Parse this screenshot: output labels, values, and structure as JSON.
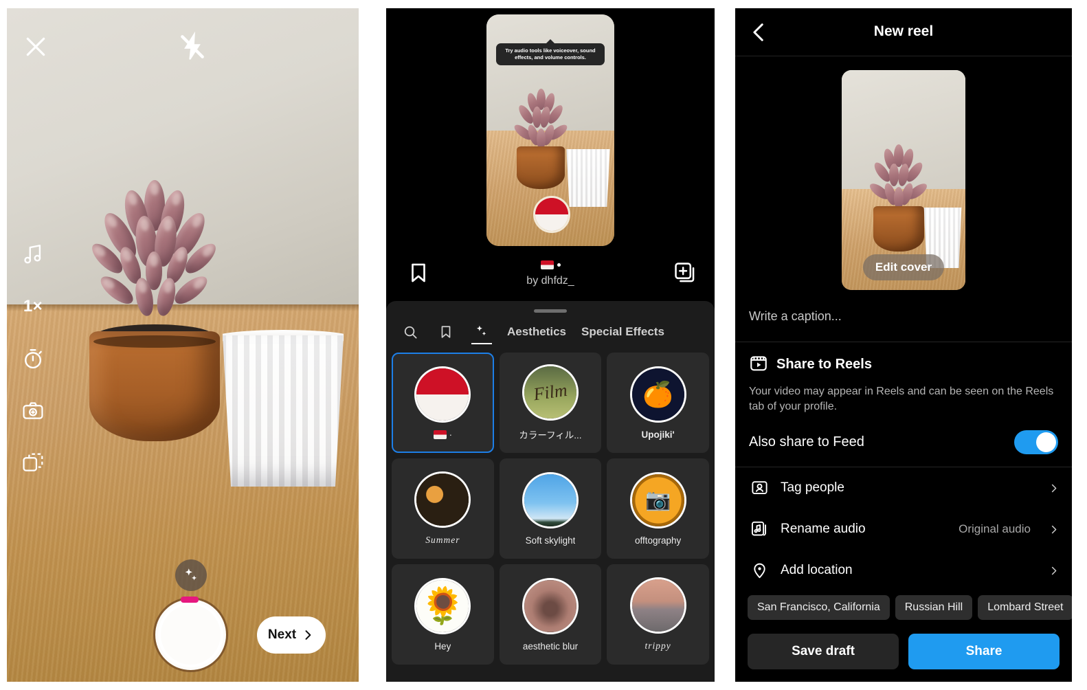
{
  "camera": {
    "close_icon": "close-icon",
    "flash_icon": "flash-off-icon",
    "rail": [
      {
        "name": "audio",
        "icon": "music-note-icon",
        "label": ""
      },
      {
        "name": "speed",
        "icon": "speed-icon",
        "label": "1×"
      },
      {
        "name": "timer",
        "icon": "timer-icon",
        "label": ""
      },
      {
        "name": "effects-camera",
        "icon": "camera-effects-icon",
        "label": ""
      },
      {
        "name": "layout",
        "icon": "layout-icon",
        "label": ""
      }
    ],
    "effects_button_icon": "sparkles-icon",
    "shutter_label": "",
    "next_label": "Next"
  },
  "effects": {
    "tooltip": "Try audio tools like voiceover, sound effects, and volume controls.",
    "preview_flag": "indonesia-flag",
    "actions": {
      "bookmark_icon": "bookmark-icon",
      "add_icon": "add-to-collection-icon",
      "effect_name": "🇮🇩 ·",
      "author": "by dhfdz_"
    },
    "tabs": [
      {
        "name": "search",
        "label": "",
        "icon": "search-icon",
        "active": false
      },
      {
        "name": "saved",
        "label": "",
        "icon": "bookmark-icon",
        "active": false
      },
      {
        "name": "sparkles",
        "label": "",
        "icon": "sparkles-icon",
        "active": true
      },
      {
        "name": "aesthetics",
        "label": "Aesthetics",
        "icon": "",
        "active": false
      },
      {
        "name": "special-effects",
        "label": "Special Effects",
        "icon": "",
        "active": false
      }
    ],
    "filters": [
      {
        "label": "🇮🇩 ·",
        "thumb": "flag-id",
        "selected": true,
        "style": "flagrow"
      },
      {
        "label": "カラーフィル...",
        "thumb": "forest",
        "selected": false,
        "style": ""
      },
      {
        "label": "Upojiki'",
        "thumb": "upojiki",
        "selected": false,
        "style": "bold"
      },
      {
        "label": "Summer",
        "thumb": "summer",
        "selected": false,
        "style": "script"
      },
      {
        "label": "Soft skylight",
        "thumb": "skylight",
        "selected": false,
        "style": ""
      },
      {
        "label": "offtography",
        "thumb": "offtography",
        "selected": false,
        "style": ""
      },
      {
        "label": "Hey",
        "thumb": "hey",
        "selected": false,
        "style": ""
      },
      {
        "label": "aesthetic blur",
        "thumb": "blur",
        "selected": false,
        "style": ""
      },
      {
        "label": "trippy",
        "thumb": "trippy",
        "selected": false,
        "style": "script"
      }
    ]
  },
  "reel": {
    "back_icon": "chevron-left-icon",
    "title": "New reel",
    "edit_cover_label": "Edit cover",
    "caption_placeholder": "Write a caption...",
    "share_section": {
      "icon": "reels-icon",
      "title": "Share to Reels",
      "description": "Your video may appear in Reels and can be seen on the Reels tab of your profile.",
      "feed_label": "Also share to Feed",
      "feed_toggle_on": true,
      "toggle_color": "#1f9bf0"
    },
    "options": [
      {
        "icon": "tag-people-icon",
        "label": "Tag people",
        "value": ""
      },
      {
        "icon": "audio-note-icon",
        "label": "Rename audio",
        "value": "Original audio"
      },
      {
        "icon": "location-pin-icon",
        "label": "Add location",
        "value": ""
      }
    ],
    "location_chips": [
      "San Francisco, California",
      "Russian Hill",
      "Lombard Street"
    ],
    "footer": {
      "save_draft_label": "Save draft",
      "share_label": "Share",
      "share_color": "#1f9bf0"
    }
  }
}
